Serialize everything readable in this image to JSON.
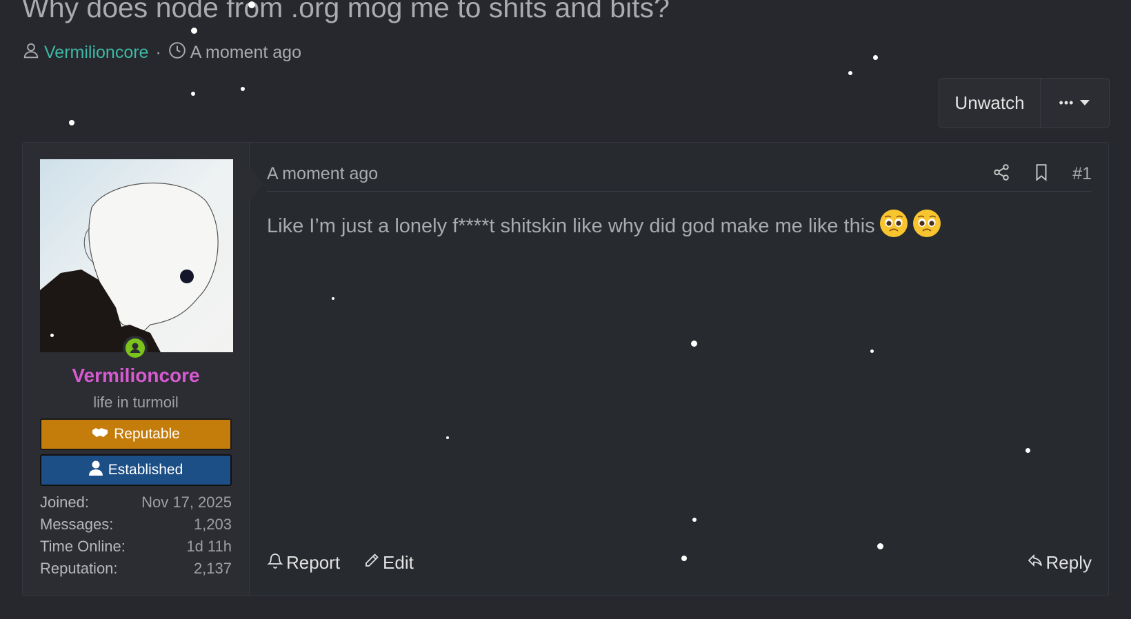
{
  "thread": {
    "title": "Why does node from .org mog me to shits and bits?",
    "author": "Vermilioncore",
    "separator": "·",
    "time": "A moment ago",
    "unwatch_label": "Unwatch",
    "more_label": "•••"
  },
  "post": {
    "date": "A moment ago",
    "number": "#1",
    "body": "Like I’m just a lonely f****t shitskin like why did god make me like this",
    "emoji": "pleading-face",
    "report_label": "Report",
    "edit_label": "Edit",
    "reply_label": "Reply"
  },
  "user": {
    "name": "Vermilioncore",
    "title": "life in turmoil",
    "banners": [
      {
        "label": "Reputable",
        "icon": "handshake-icon",
        "color": "#c47c0a"
      },
      {
        "label": "Established",
        "icon": "user-icon",
        "color": "#1d4f87"
      }
    ],
    "stats": [
      {
        "label": "Joined:",
        "value": "Nov 17, 2025"
      },
      {
        "label": "Messages:",
        "value": "1,203"
      },
      {
        "label": "Time Online:",
        "value": "1d 11h"
      },
      {
        "label": "Reputation:",
        "value": "2,137"
      }
    ]
  },
  "colors": {
    "background": "#26282d",
    "username_accent": "#d85ad2",
    "author_link": "#3fb8a6",
    "online": "#7cc31c"
  }
}
